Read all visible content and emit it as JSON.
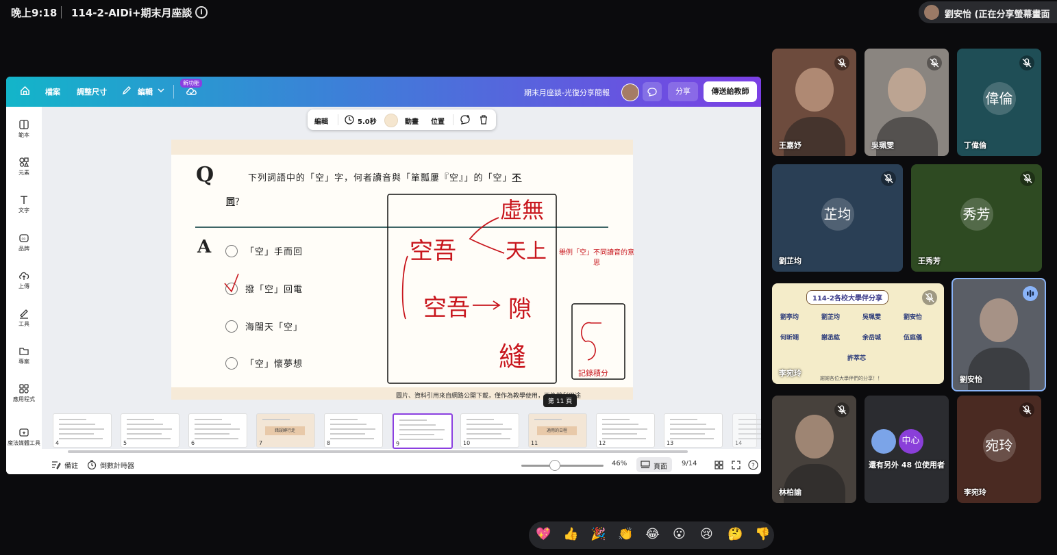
{
  "meeting": {
    "time": "晚上9:18",
    "title": "114-2-AIDi+期末月座談",
    "presenter_status": "劉安怡 (正在分享螢幕畫面"
  },
  "canva": {
    "menu": {
      "file": "檔案",
      "resize": "調整尺寸",
      "edit": "編輯",
      "new_badge": "新功能"
    },
    "doc_title": "期末月座談-光復分享簡報",
    "share": "分享",
    "send": "傳送給教師",
    "left_rail": [
      "範本",
      "元素",
      "文字",
      "品牌",
      "上傳",
      "工具",
      "專案",
      "應用程式",
      "魔法媒體工具"
    ],
    "context_bar": {
      "edit": "編輯",
      "duration": "5.0秒",
      "animate": "動畫",
      "position": "位置"
    },
    "slide": {
      "q_mark": "Q",
      "question_line1": "下列詞語中的「空」字，何者讀音與「箪瓢屢『空』」的「空」",
      "question_bold": "不",
      "question_line2_bold": "同",
      "question_line2_rest": "？",
      "a_mark": "A",
      "options": [
        "「空」手而回",
        "撥「空」回電",
        "海闊天「空」",
        "「空」懷夢想"
      ],
      "annotation": "舉例「空」不同讀音的意思",
      "score_label": "記錄積分",
      "footer": "圖片、資料引用來自網路公開下載，僅作為教學使用，不為營利用途",
      "handwriting": {
        "top_right": "虛無",
        "mid_right": "天上",
        "left_top": "空吾",
        "left_bottom": "空吾",
        "arrow_word": "隙",
        "bottom": "縫",
        "score": "5"
      }
    },
    "thumbnails": [
      {
        "n": "4",
        "label": ""
      },
      {
        "n": "5",
        "label": ""
      },
      {
        "n": "6",
        "label": ""
      },
      {
        "n": "7",
        "label": "錯誤轉行走"
      },
      {
        "n": "8",
        "label": ""
      },
      {
        "n": "9",
        "label": ""
      },
      {
        "n": "10",
        "label": ""
      },
      {
        "n": "11",
        "label": "適用的日程"
      },
      {
        "n": "12",
        "label": ""
      },
      {
        "n": "13",
        "label": ""
      },
      {
        "n": "14",
        "label": ""
      }
    ],
    "tooltip": "第 11 頁",
    "bottom": {
      "notes": "備註",
      "timer": "倒數計時器",
      "zoom": "46%",
      "page_view": "頁面",
      "page_count": "9/14"
    }
  },
  "participants": [
    {
      "name": "王嘉妤",
      "initials": "",
      "muted": true,
      "color": "#6d4b3d"
    },
    {
      "name": "吳珮雯",
      "initials": "",
      "muted": true,
      "color": "#8a8580"
    },
    {
      "name": "丁偉倫",
      "initials": "偉倫",
      "muted": true,
      "color": "#1f4e56"
    },
    {
      "name": "劉芷均",
      "initials": "芷均",
      "muted": true,
      "color": "#2a3f55"
    },
    {
      "name": "王秀芳",
      "initials": "秀芳",
      "muted": true,
      "color": "#2e4a22"
    },
    {
      "name": "李宛玲",
      "initials": "",
      "muted": true,
      "color": "#e9dcb9"
    },
    {
      "name": "劉安怡",
      "initials": "",
      "muted": false,
      "color": "#5a5e66"
    },
    {
      "name": "林柏諭",
      "initials": "",
      "muted": true,
      "color": "#47413c"
    },
    {
      "name": "還有另外 48 位使用者",
      "initials": "中心",
      "muted": false,
      "color": "#2b2c30"
    },
    {
      "name": "李宛玲",
      "initials": "宛玲",
      "muted": true,
      "color": "#4a2a22"
    }
  ],
  "share_slide": {
    "title": "114-2各校大學伴分享",
    "names": [
      "劉亭均",
      "劉芷均",
      "吳珮雯",
      "劉安怡",
      "何昕翊",
      "謝丞紘",
      "余岳城",
      "伍庭儀",
      "許萃芯"
    ],
    "footer": "謝謝各位大學伴們的分享！！"
  },
  "reactions": [
    "💖",
    "👍",
    "🎉",
    "👏",
    "😂",
    "😮",
    "😢",
    "🤔",
    "👎"
  ]
}
